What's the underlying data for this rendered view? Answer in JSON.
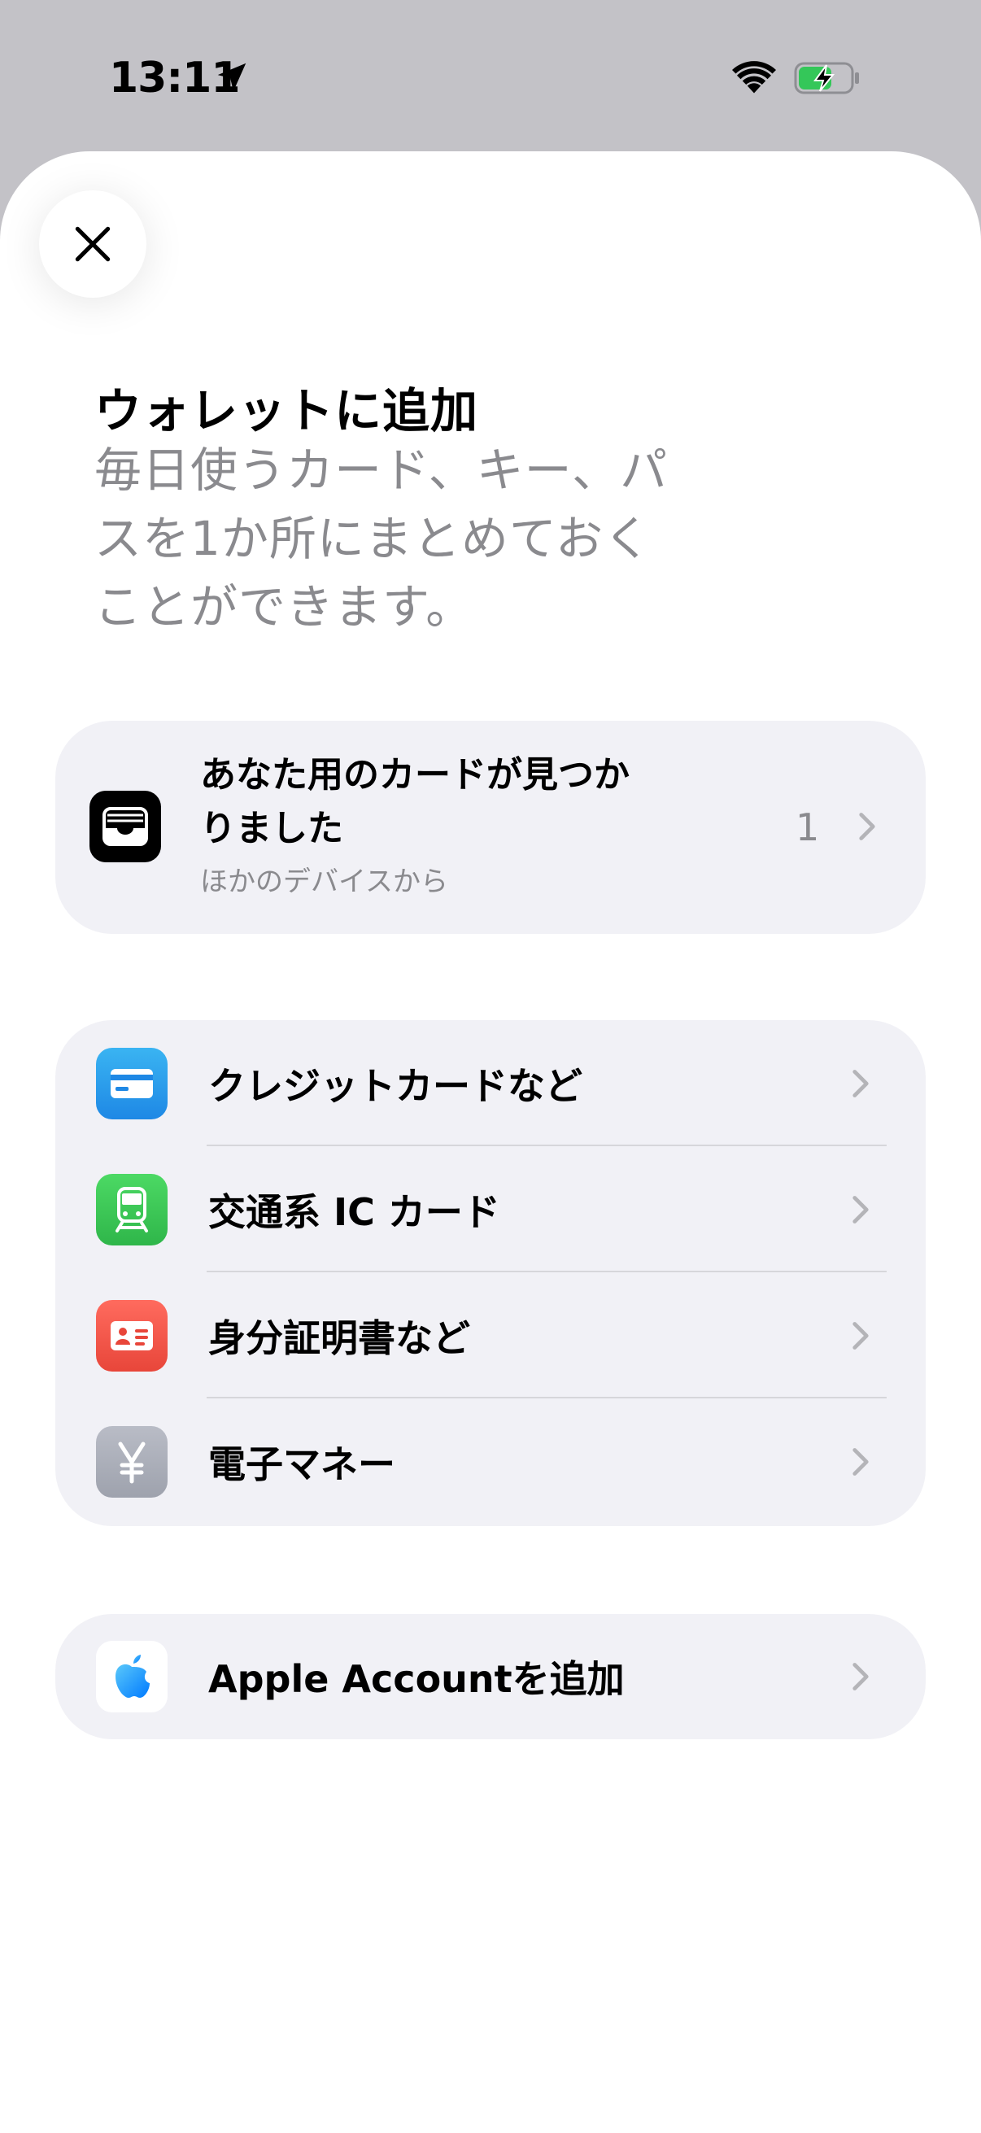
{
  "status_bar": {
    "time": "13:11",
    "icons": [
      "location-arrow-icon",
      "wifi-icon",
      "battery-charging-icon"
    ],
    "battery_color": "#34c759"
  },
  "sheet": {
    "close_icon": "close-icon",
    "title": "ウォレットに追加",
    "subtitle": "毎日使うカード、キー、パスを1か所にまとめておくことができます。"
  },
  "found_card": {
    "icon": "wallet-icon",
    "title": "あなた用のカードが見つかりました",
    "subtitle": "ほかのデバイスから",
    "count": "1"
  },
  "options": [
    {
      "label": "クレジットカードなど",
      "icon": "credit-card-icon",
      "color": "#2196f3"
    },
    {
      "label": "交通系 IC カード",
      "icon": "train-icon",
      "color": "#34c759"
    },
    {
      "label": "身分証明書など",
      "icon": "id-card-icon",
      "color": "#f0584a"
    },
    {
      "label": "電子マネー",
      "icon": "yen-icon",
      "color": "#a9adb8"
    }
  ],
  "apple_account": {
    "label": "Apple Accountを追加",
    "icon": "apple-icon"
  },
  "colors": {
    "backdrop": "#c3c2c7",
    "card_bg": "#f1f1f6",
    "secondary_text": "#8a8a8e"
  }
}
